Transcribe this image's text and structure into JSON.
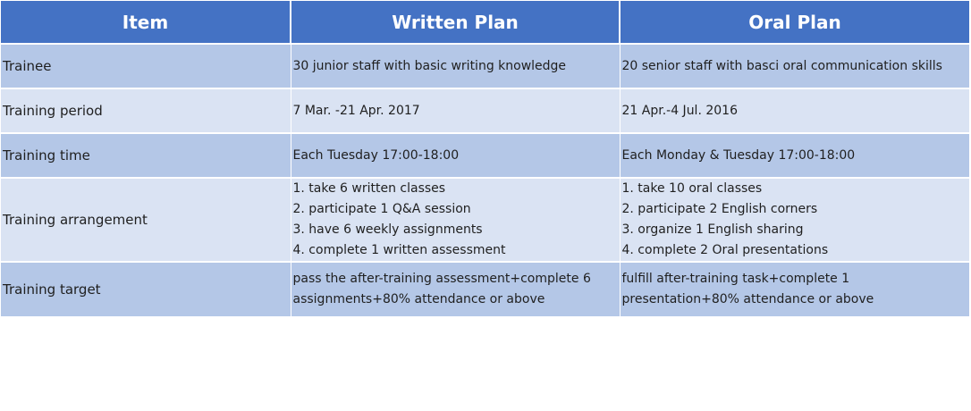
{
  "header": {
    "col1": "Item",
    "col2": "Written Plan",
    "col3": "Oral Plan"
  },
  "rows": [
    {
      "label": "Trainee",
      "written": [
        "30 junior staff with basic writing knowledge"
      ],
      "oral": [
        "20 senior staff with basci oral communication skills"
      ]
    },
    {
      "label": "Training period",
      "written": [
        "7 Mar. -21 Apr. 2017"
      ],
      "oral": [
        "21 Apr.-4 Jul. 2016"
      ]
    },
    {
      "label": "Training time",
      "written": [
        "Each Tuesday 17:00-18:00"
      ],
      "oral": [
        "Each Monday & Tuesday 17:00-18:00"
      ]
    },
    {
      "label": "Training arrangement",
      "written": [
        "1. take 6 written classes",
        "2. participate 1 Q&A session",
        "3. have 6 weekly assignments",
        "4. complete 1 written assessment"
      ],
      "oral": [
        "1. take 10 oral classes",
        "2. participate 2 English corners",
        "3. organize 1 English sharing",
        "4. complete 2 Oral presentations"
      ]
    },
    {
      "label": "Training target",
      "written": [
        "pass the after-training assessment+complete 6 assignments+80% attendance or above"
      ],
      "oral": [
        "fulfill after-training task+complete 1 presentation+80% attendance or above"
      ]
    }
  ],
  "colors": {
    "header_bg": "#4472c4",
    "row_dark": "#b4c7e7",
    "row_light": "#dae3f3"
  }
}
